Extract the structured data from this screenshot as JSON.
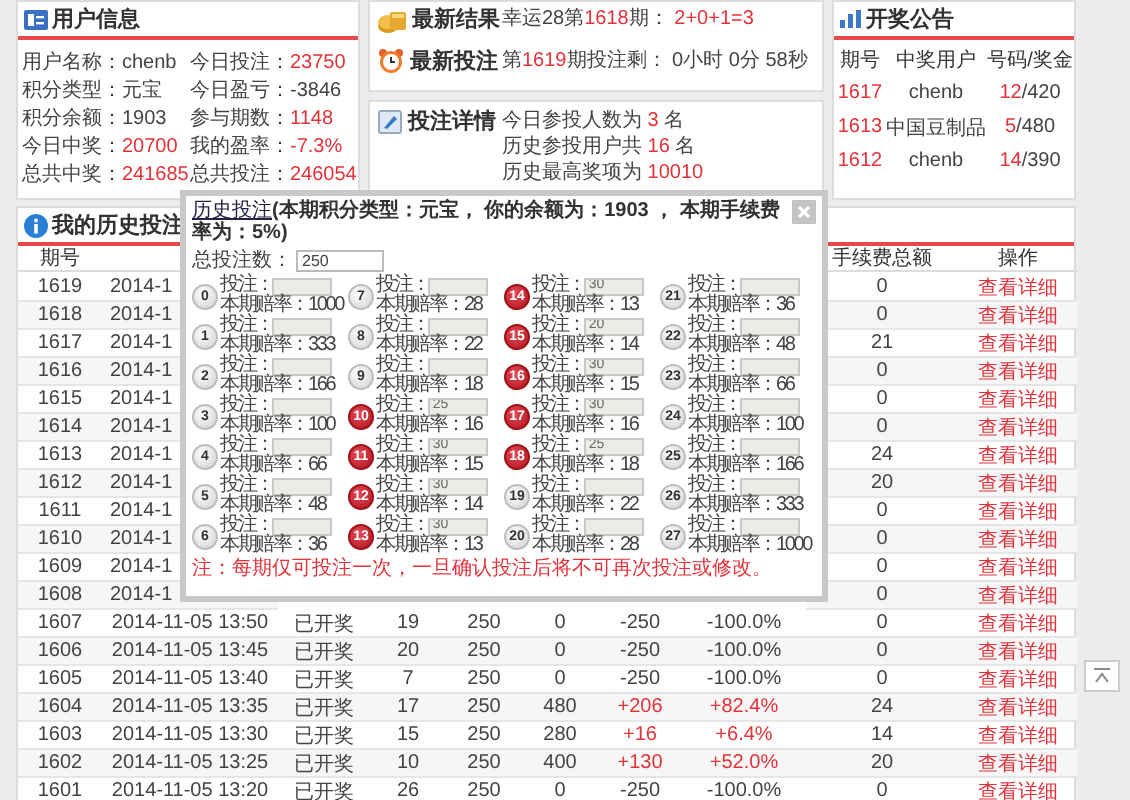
{
  "user_info": {
    "title": "用户信息",
    "rows": [
      {
        "label": "用户名称：",
        "value": "chenb",
        "highlighted": false
      },
      {
        "label": "今日投注：",
        "value": "23750",
        "highlighted": true
      },
      {
        "label": "积分类型：",
        "value": "元宝",
        "highlighted": false
      },
      {
        "label": "今日盈亏：",
        "value": "-3846",
        "highlighted": false
      },
      {
        "label": "积分余额：",
        "value": "1903",
        "highlighted": false
      },
      {
        "label": "参与期数：",
        "value": "1148",
        "highlighted": true
      },
      {
        "label": "今日中奖：",
        "value": "20700",
        "highlighted": true
      },
      {
        "label": "我的盈率：",
        "value": "-7.3%",
        "highlighted": true
      },
      {
        "label": "总共中奖：",
        "value": "241685",
        "highlighted": true
      },
      {
        "label": "总共投注：",
        "value": "246054",
        "highlighted": true
      }
    ]
  },
  "latest": {
    "result": {
      "title": "最新结果",
      "prefix": "幸运28第",
      "period": "1618",
      "suffix": "期：",
      "value": "2+0+1=3"
    },
    "bet": {
      "title": "最新投注",
      "prefix": "第",
      "period": "1619",
      "suffix": "期投注剩：",
      "countdown": "0小时 0分 58秒"
    }
  },
  "bet_details": {
    "title": "投注详情",
    "lines": [
      {
        "prefix": "今日参投人数为",
        "value": "3",
        "suffix": "名"
      },
      {
        "prefix": "历史参投用户共",
        "value": "16",
        "suffix": "名"
      },
      {
        "prefix": "历史最高奖项为",
        "value": "10010"
      }
    ]
  },
  "announcements": {
    "title": "开奖公告",
    "columns": [
      "期号",
      "中奖用户",
      "号码/奖金"
    ],
    "rows": [
      {
        "period": "1617",
        "user": "chenb",
        "number": "12",
        "prize": "/420"
      },
      {
        "period": "1613",
        "user": "中国豆制品",
        "number": "5",
        "prize": "/480"
      },
      {
        "period": "1612",
        "user": "chenb",
        "number": "14",
        "prize": "/390"
      }
    ]
  },
  "history": {
    "title": "我的历史投注",
    "columns": {
      "period": "期号",
      "fee": "手续费总额",
      "action": "操作"
    },
    "rows": [
      {
        "period": "1619",
        "date": "2014-1",
        "fee": "0",
        "action": "查看详细"
      },
      {
        "period": "1618",
        "date": "2014-1",
        "fee": "0",
        "action": "查看详细"
      },
      {
        "period": "1617",
        "date": "2014-1",
        "fee": "21",
        "action": "查看详细"
      },
      {
        "period": "1616",
        "date": "2014-1",
        "fee": "0",
        "action": "查看详细"
      },
      {
        "period": "1615",
        "date": "2014-1",
        "fee": "0",
        "action": "查看详细"
      },
      {
        "period": "1614",
        "date": "2014-1",
        "fee": "0",
        "action": "查看详细"
      },
      {
        "period": "1613",
        "date": "2014-1",
        "fee": "24",
        "action": "查看详细"
      },
      {
        "period": "1612",
        "date": "2014-1",
        "fee": "20",
        "action": "查看详细"
      },
      {
        "period": "1611",
        "date": "2014-1",
        "fee": "0",
        "action": "查看详细"
      },
      {
        "period": "1610",
        "date": "2014-1",
        "fee": "0",
        "action": "查看详细"
      },
      {
        "period": "1609",
        "date": "2014-1",
        "fee": "0",
        "action": "查看详细"
      },
      {
        "period": "1608",
        "date": "2014-1",
        "fee": "0",
        "action": "查看详细"
      },
      {
        "period": "1607",
        "date": "2014-11-05 13:50",
        "status": "已开奖",
        "number": "19",
        "bet": "250",
        "win": "0",
        "profit": "-250",
        "rate": "-100.0%",
        "fee": "0",
        "action": "查看详细",
        "highlighted": false
      },
      {
        "period": "1606",
        "date": "2014-11-05 13:45",
        "status": "已开奖",
        "number": "20",
        "bet": "250",
        "win": "0",
        "profit": "-250",
        "rate": "-100.0%",
        "fee": "0",
        "action": "查看详细",
        "highlighted": false
      },
      {
        "period": "1605",
        "date": "2014-11-05 13:40",
        "status": "已开奖",
        "number": "7",
        "bet": "250",
        "win": "0",
        "profit": "-250",
        "rate": "-100.0%",
        "fee": "0",
        "action": "查看详细",
        "highlighted": false
      },
      {
        "period": "1604",
        "date": "2014-11-05 13:35",
        "status": "已开奖",
        "number": "17",
        "bet": "250",
        "win": "480",
        "profit": "+206",
        "rate": "+82.4%",
        "fee": "24",
        "action": "查看详细",
        "highlighted": true
      },
      {
        "period": "1603",
        "date": "2014-11-05 13:30",
        "status": "已开奖",
        "number": "15",
        "bet": "250",
        "win": "280",
        "profit": "+16",
        "rate": "+6.4%",
        "fee": "14",
        "action": "查看详细",
        "highlighted": true
      },
      {
        "period": "1602",
        "date": "2014-11-05 13:25",
        "status": "已开奖",
        "number": "10",
        "bet": "250",
        "win": "400",
        "profit": "+130",
        "rate": "+52.0%",
        "fee": "20",
        "action": "查看详细",
        "highlighted": true
      },
      {
        "period": "1601",
        "date": "2014-11-05 13:20",
        "status": "已开奖",
        "number": "26",
        "bet": "250",
        "win": "0",
        "profit": "-250",
        "rate": "-100.0%",
        "fee": "0",
        "action": "查看详细",
        "highlighted": false
      }
    ]
  },
  "modal": {
    "title": "历史投注",
    "subtitle": "(本期积分类型：元宝， 你的余额为：1903 ， 本期手续费率为：5%)",
    "total_label": "总投注数：",
    "total": "250",
    "balls": [
      {
        "number": "0",
        "bet_label": "投注：",
        "odds": "本期赔率：1000",
        "selected": false
      },
      {
        "number": "1",
        "bet_label": "投注：",
        "odds": "本期赔率：333",
        "selected": false
      },
      {
        "number": "2",
        "bet_label": "投注：",
        "odds": "本期赔率：166",
        "selected": false
      },
      {
        "number": "3",
        "bet_label": "投注：",
        "odds": "本期赔率：100",
        "selected": false
      },
      {
        "number": "4",
        "bet_label": "投注：",
        "odds": "本期赔率：66",
        "selected": false
      },
      {
        "number": "5",
        "bet_label": "投注：",
        "odds": "本期赔率：48",
        "selected": false
      },
      {
        "number": "6",
        "bet_label": "投注：",
        "odds": "本期赔率：36",
        "selected": false
      },
      {
        "number": "7",
        "bet_label": "投注：",
        "odds": "本期赔率：28",
        "selected": false
      },
      {
        "number": "8",
        "bet_label": "投注：",
        "odds": "本期赔率：22",
        "selected": false
      },
      {
        "number": "9",
        "bet_label": "投注：",
        "odds": "本期赔率：18",
        "selected": false
      },
      {
        "number": "10",
        "bet_label": "投注：",
        "bet": "25",
        "odds": "本期赔率：16",
        "selected": true
      },
      {
        "number": "11",
        "bet_label": "投注：",
        "bet": "30",
        "odds": "本期赔率：15",
        "selected": true
      },
      {
        "number": "12",
        "bet_label": "投注：",
        "bet": "30",
        "odds": "本期赔率：14",
        "selected": true
      },
      {
        "number": "13",
        "bet_label": "投注：",
        "bet": "30",
        "odds": "本期赔率：13",
        "selected": true
      },
      {
        "number": "14",
        "bet_label": "投注：",
        "bet": "30",
        "odds": "本期赔率：13",
        "selected": true
      },
      {
        "number": "15",
        "bet_label": "投注：",
        "bet": "20",
        "odds": "本期赔率：14",
        "selected": true
      },
      {
        "number": "16",
        "bet_label": "投注：",
        "bet": "30",
        "odds": "本期赔率：15",
        "selected": true
      },
      {
        "number": "17",
        "bet_label": "投注：",
        "bet": "30",
        "odds": "本期赔率：16",
        "selected": true
      },
      {
        "number": "18",
        "bet_label": "投注：",
        "bet": "25",
        "odds": "本期赔率：18",
        "selected": true
      },
      {
        "number": "19",
        "bet_label": "投注：",
        "odds": "本期赔率：22",
        "selected": false
      },
      {
        "number": "20",
        "bet_label": "投注：",
        "odds": "本期赔率：28",
        "selected": false
      },
      {
        "number": "21",
        "bet_label": "投注：",
        "odds": "本期赔率：36",
        "selected": false
      },
      {
        "number": "22",
        "bet_label": "投注：",
        "odds": "本期赔率：48",
        "selected": false
      },
      {
        "number": "23",
        "bet_label": "投注：",
        "odds": "本期赔率：66",
        "selected": false
      },
      {
        "number": "24",
        "bet_label": "投注：",
        "odds": "本期赔率：100",
        "selected": false
      },
      {
        "number": "25",
        "bet_label": "投注：",
        "odds": "本期赔率：166",
        "selected": false
      },
      {
        "number": "26",
        "bet_label": "投注：",
        "odds": "本期赔率：333",
        "selected": false
      },
      {
        "number": "27",
        "bet_label": "投注：",
        "odds": "本期赔率：1000",
        "selected": false
      }
    ],
    "note": "注：每期仅可投注一次，一旦确认投注后将不可再次投注或修改。"
  }
}
